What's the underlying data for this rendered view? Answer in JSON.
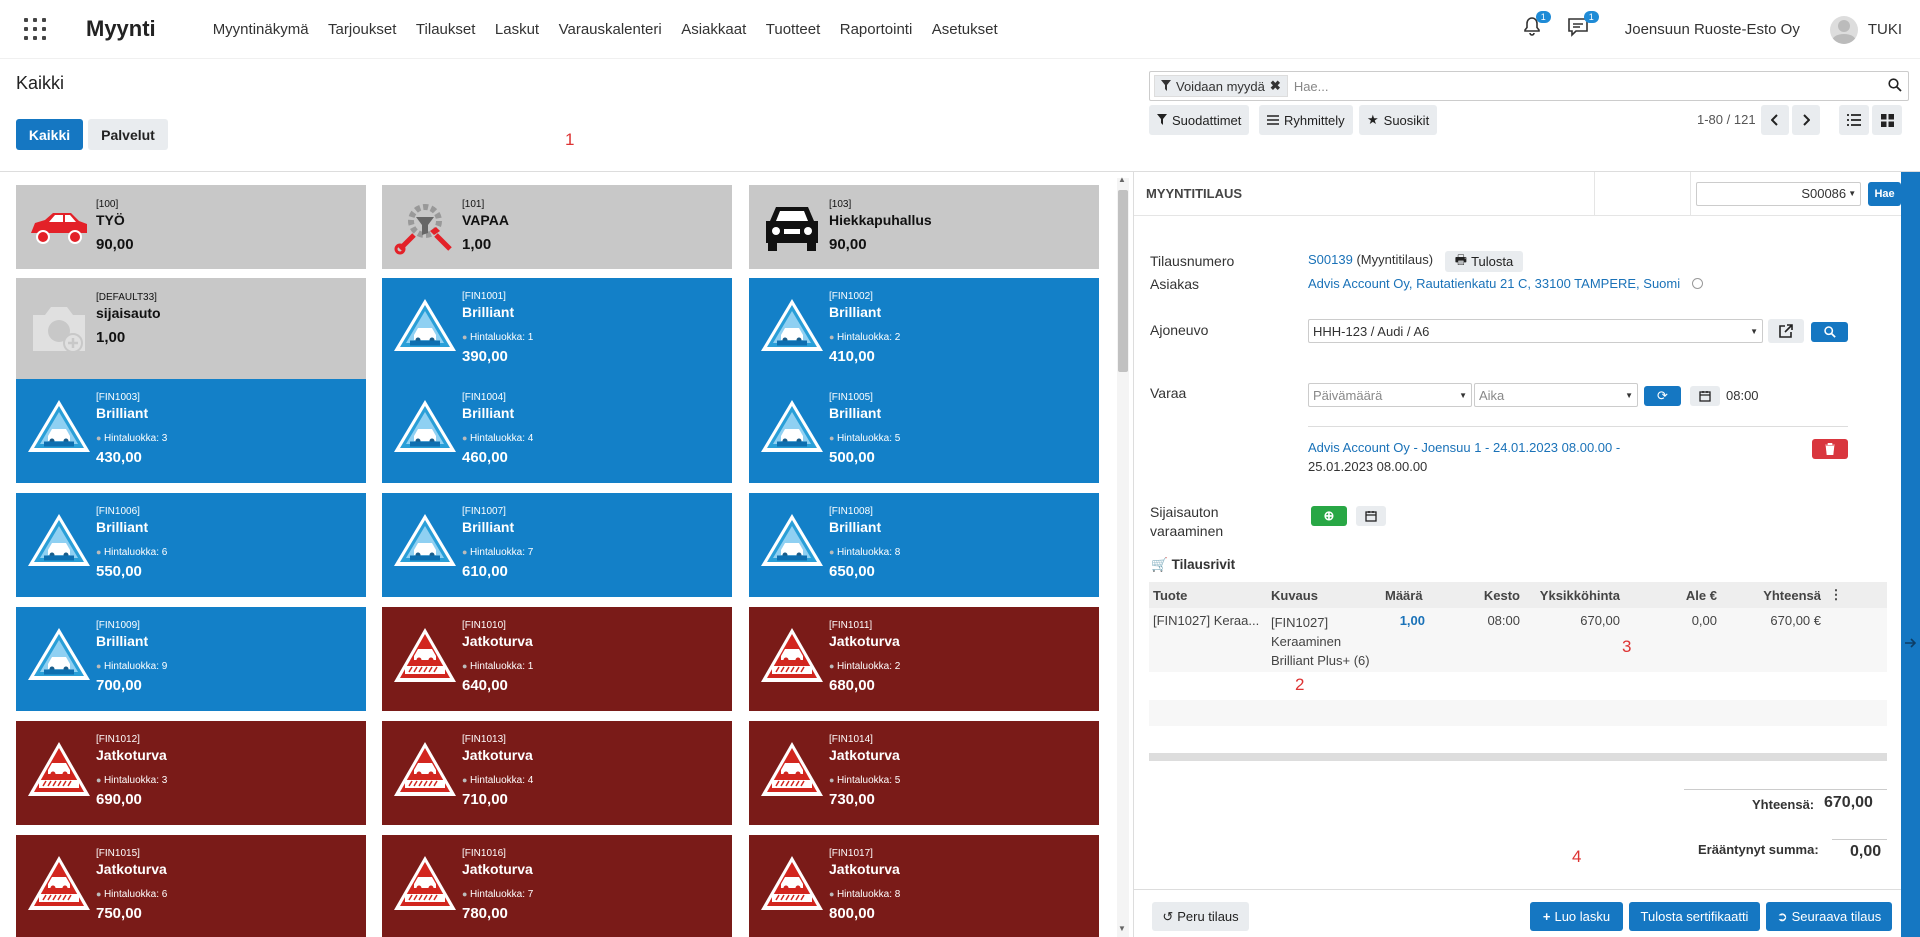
{
  "app": {
    "name": "Myynti"
  },
  "menu": [
    "Myyntinäkymä",
    "Tarjoukset",
    "Tilaukset",
    "Laskut",
    "Varauskalenteri",
    "Asiakkaat",
    "Tuotteet",
    "Raportointi",
    "Asetukset"
  ],
  "notifications": {
    "activity_count": "1",
    "message_count": "1"
  },
  "company": "Joensuun Ruoste-Esto Oy",
  "user": "TUKI",
  "page_title": "Kaikki",
  "filters": {
    "all_label": "Kaikki",
    "services_label": "Palvelut"
  },
  "search": {
    "facet": "Voidaan myydä",
    "placeholder": "Hae..."
  },
  "toolbar": {
    "filters": "Suodattimet",
    "group": "Ryhmittely",
    "favorites": "Suosikit",
    "pager": "1-80 / 121"
  },
  "markers": {
    "m1": "1",
    "m2": "2",
    "m3": "3",
    "m4": "4"
  },
  "products": [
    {
      "code": "[100]",
      "name": "TYÖ",
      "price": "90,00",
      "color": "gray",
      "icon": "car-red-icon"
    },
    {
      "code": "[101]",
      "name": "VAPAA",
      "price": "1,00",
      "color": "gray",
      "icon": "gear-tools-icon"
    },
    {
      "code": "[103]",
      "name": "Hiekkapuhallus",
      "price": "90,00",
      "color": "gray",
      "icon": "car-black-icon"
    },
    {
      "code": "[DEFAULT33]",
      "name": "sijaisauto",
      "price": "1,00",
      "color": "gray",
      "icon": "camera-placeholder-icon"
    },
    {
      "code": "[FIN1001]",
      "name": "Brilliant",
      "class": "Hintaluokka: 1",
      "price": "390,00",
      "color": "blue",
      "icon": "brilliant-logo-icon"
    },
    {
      "code": "[FIN1002]",
      "name": "Brilliant",
      "class": "Hintaluokka: 2",
      "price": "410,00",
      "color": "blue",
      "icon": "brilliant-logo-icon"
    },
    {
      "code": "[FIN1003]",
      "name": "Brilliant",
      "class": "Hintaluokka: 3",
      "price": "430,00",
      "color": "blue",
      "icon": "brilliant-logo-icon"
    },
    {
      "code": "[FIN1004]",
      "name": "Brilliant",
      "class": "Hintaluokka: 4",
      "price": "460,00",
      "color": "blue",
      "icon": "brilliant-logo-icon"
    },
    {
      "code": "[FIN1005]",
      "name": "Brilliant",
      "class": "Hintaluokka: 5",
      "price": "500,00",
      "color": "blue",
      "icon": "brilliant-logo-icon"
    },
    {
      "code": "[FIN1006]",
      "name": "Brilliant",
      "class": "Hintaluokka: 6",
      "price": "550,00",
      "color": "blue",
      "icon": "brilliant-logo-icon"
    },
    {
      "code": "[FIN1007]",
      "name": "Brilliant",
      "class": "Hintaluokka: 7",
      "price": "610,00",
      "color": "blue",
      "icon": "brilliant-logo-icon"
    },
    {
      "code": "[FIN1008]",
      "name": "Brilliant",
      "class": "Hintaluokka: 8",
      "price": "650,00",
      "color": "blue",
      "icon": "brilliant-logo-icon"
    },
    {
      "code": "[FIN1009]",
      "name": "Brilliant",
      "class": "Hintaluokka: 9",
      "price": "700,00",
      "color": "blue",
      "icon": "brilliant-logo-icon"
    },
    {
      "code": "[FIN1010]",
      "name": "Jatkoturva",
      "class": "Hintaluokka: 1",
      "price": "640,00",
      "color": "maroon",
      "icon": "finikor-logo-icon"
    },
    {
      "code": "[FIN1011]",
      "name": "Jatkoturva",
      "class": "Hintaluokka: 2",
      "price": "680,00",
      "color": "maroon",
      "icon": "finikor-logo-icon"
    },
    {
      "code": "[FIN1012]",
      "name": "Jatkoturva",
      "class": "Hintaluokka: 3",
      "price": "690,00",
      "color": "maroon",
      "icon": "finikor-logo-icon"
    },
    {
      "code": "[FIN1013]",
      "name": "Jatkoturva",
      "class": "Hintaluokka: 4",
      "price": "710,00",
      "color": "maroon",
      "icon": "finikor-logo-icon"
    },
    {
      "code": "[FIN1014]",
      "name": "Jatkoturva",
      "class": "Hintaluokka: 5",
      "price": "730,00",
      "color": "maroon",
      "icon": "finikor-logo-icon"
    },
    {
      "code": "[FIN1015]",
      "name": "Jatkoturva",
      "class": "Hintaluokka: 6",
      "price": "750,00",
      "color": "maroon",
      "icon": "finikor-logo-icon"
    },
    {
      "code": "[FIN1016]",
      "name": "Jatkoturva",
      "class": "Hintaluokka: 7",
      "price": "780,00",
      "color": "maroon",
      "icon": "finikor-logo-icon"
    },
    {
      "code": "[FIN1017]",
      "name": "Jatkoturva",
      "class": "Hintaluokka: 8",
      "price": "800,00",
      "color": "maroon",
      "icon": "finikor-logo-icon"
    }
  ],
  "order": {
    "header": "MYYNTITILAUS",
    "order_select": "S00086",
    "fetch_button": "Hae",
    "number_label": "Tilausnumero",
    "number_value": "S00139",
    "number_type": "(Myyntitilaus)",
    "print_button": "Tulosta",
    "customer_label": "Asiakas",
    "customer_value": "Advis Account Oy, Rautatienkatu 21 C, 33100 TAMPERE, Suomi",
    "vehicle_label": "Ajoneuvo",
    "vehicle_value": "HHH-123 / Audi / A6",
    "reserve_label": "Varaa",
    "date_placeholder": "Päivämäärä",
    "time_placeholder": "Aika",
    "time_value": "08:00",
    "booking_line1": "Advis Account Oy - Joensuu 1 - 24.01.2023 08.00.00 -",
    "booking_line2": "25.01.2023 08.00.00",
    "replacement_label1": "Sijaisauton",
    "replacement_label2": "varaaminen",
    "lines_title": "Tilausrivit",
    "columns": [
      "Tuote",
      "Kuvaus",
      "Määrä",
      "Kesto",
      "Yksikköhinta",
      "Ale €",
      "Yhteensä"
    ],
    "line": {
      "product": "[FIN1027] Keraa...",
      "desc1": "[FIN1027]",
      "desc2": "Keraaminen",
      "desc3": "Brilliant Plus+ (6)",
      "qty": "1,00",
      "duration": "08:00",
      "unit_price": "670,00",
      "discount": "0,00",
      "total": "670,00 €"
    },
    "total_label": "Yhteensä:",
    "total_value": "670,00",
    "due_label": "Erääntynyt summa:",
    "due_value": "0,00",
    "cancel_button": "Peru tilaus",
    "invoice_button": "Luo lasku",
    "certificate_button": "Tulosta sertifikaatti",
    "next_button": "Seuraava tilaus"
  }
}
